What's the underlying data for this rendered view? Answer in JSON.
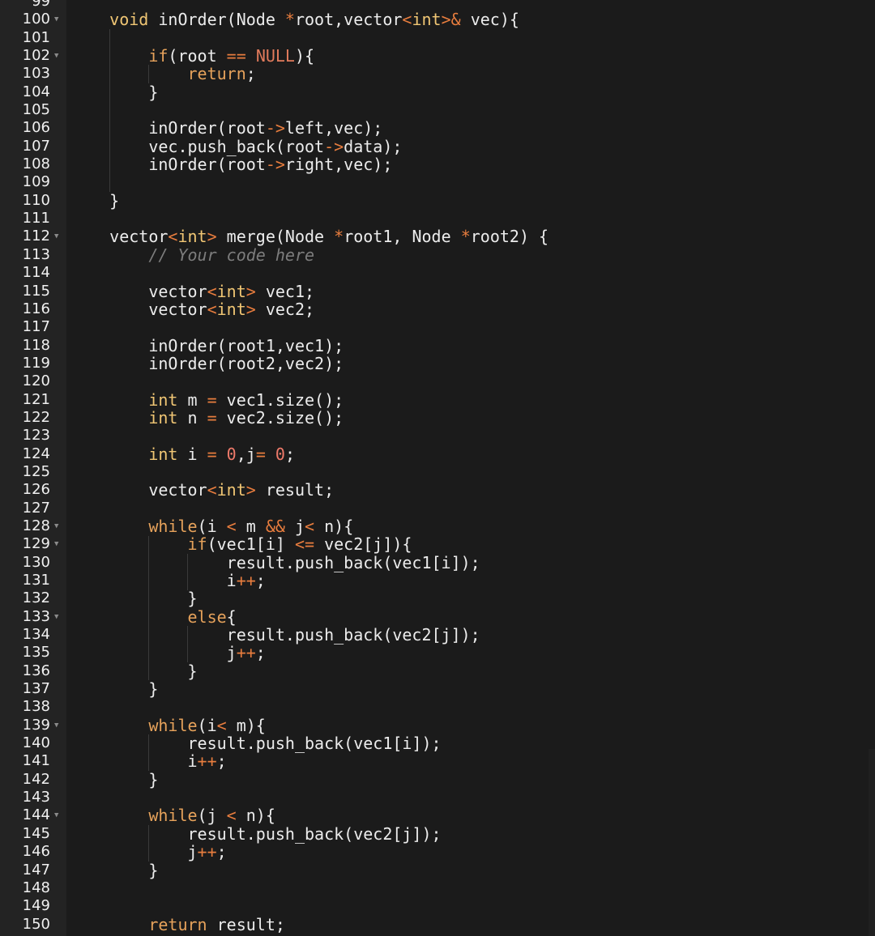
{
  "editor": {
    "first_line_number": 99,
    "folded_lines": [
      100,
      102,
      112,
      128,
      129,
      133,
      139,
      144
    ],
    "colors": {
      "background": "#1b1b1b",
      "gutter": "#232323",
      "text": "#ececec",
      "type_keyword": "#f0c674",
      "control_keyword": "#e6a25b",
      "operator": "#e87d3e",
      "number": "#ef7a6a",
      "comment": "#7d7d7d"
    },
    "lines": [
      [],
      [
        [
          "    ",
          "plain"
        ],
        [
          "void",
          "kw"
        ],
        [
          " inOrder(Node ",
          "plain"
        ],
        [
          "*",
          "op"
        ],
        [
          "root,vector",
          "plain"
        ],
        [
          "<",
          "op"
        ],
        [
          "int",
          "kw"
        ],
        [
          ">&",
          "op"
        ],
        [
          " vec){",
          "plain"
        ]
      ],
      [],
      [
        [
          "        ",
          "plain"
        ],
        [
          "if",
          "ctrl"
        ],
        [
          "(root ",
          "plain"
        ],
        [
          "==",
          "op"
        ],
        [
          " ",
          "plain"
        ],
        [
          "NULL",
          "const"
        ],
        [
          "){",
          "plain"
        ]
      ],
      [
        [
          "            ",
          "plain"
        ],
        [
          "return",
          "ctrl"
        ],
        [
          ";",
          "plain"
        ]
      ],
      [
        [
          "        }",
          "plain"
        ]
      ],
      [],
      [
        [
          "        inOrder(root",
          "plain"
        ],
        [
          "->",
          "op"
        ],
        [
          "left,vec);",
          "plain"
        ]
      ],
      [
        [
          "        vec.push_back(root",
          "plain"
        ],
        [
          "->",
          "op"
        ],
        [
          "data);",
          "plain"
        ]
      ],
      [
        [
          "        inOrder(root",
          "plain"
        ],
        [
          "->",
          "op"
        ],
        [
          "right,vec);",
          "plain"
        ]
      ],
      [],
      [
        [
          "    }",
          "plain"
        ]
      ],
      [],
      [
        [
          "    vector",
          "plain"
        ],
        [
          "<",
          "op"
        ],
        [
          "int",
          "kw"
        ],
        [
          ">",
          "op"
        ],
        [
          " merge(Node ",
          "plain"
        ],
        [
          "*",
          "op"
        ],
        [
          "root1, Node ",
          "plain"
        ],
        [
          "*",
          "op"
        ],
        [
          "root2) {",
          "plain"
        ]
      ],
      [
        [
          "        ",
          "plain"
        ],
        [
          "// Your code here",
          "comment"
        ]
      ],
      [],
      [
        [
          "        vector",
          "plain"
        ],
        [
          "<",
          "op"
        ],
        [
          "int",
          "kw"
        ],
        [
          ">",
          "op"
        ],
        [
          " vec1;",
          "plain"
        ]
      ],
      [
        [
          "        vector",
          "plain"
        ],
        [
          "<",
          "op"
        ],
        [
          "int",
          "kw"
        ],
        [
          ">",
          "op"
        ],
        [
          " vec2;",
          "plain"
        ]
      ],
      [],
      [
        [
          "        inOrder(root1,vec1);",
          "plain"
        ]
      ],
      [
        [
          "        inOrder(root2,vec2);",
          "plain"
        ]
      ],
      [],
      [
        [
          "        ",
          "plain"
        ],
        [
          "int",
          "kw"
        ],
        [
          " m ",
          "plain"
        ],
        [
          "=",
          "op"
        ],
        [
          " vec1.size();",
          "plain"
        ]
      ],
      [
        [
          "        ",
          "plain"
        ],
        [
          "int",
          "kw"
        ],
        [
          " n ",
          "plain"
        ],
        [
          "=",
          "op"
        ],
        [
          " vec2.size();",
          "plain"
        ]
      ],
      [],
      [
        [
          "        ",
          "plain"
        ],
        [
          "int",
          "kw"
        ],
        [
          " i ",
          "plain"
        ],
        [
          "=",
          "op"
        ],
        [
          " ",
          "plain"
        ],
        [
          "0",
          "num"
        ],
        [
          ",j",
          "plain"
        ],
        [
          "=",
          "op"
        ],
        [
          " ",
          "plain"
        ],
        [
          "0",
          "num"
        ],
        [
          ";",
          "plain"
        ]
      ],
      [],
      [
        [
          "        vector",
          "plain"
        ],
        [
          "<",
          "op"
        ],
        [
          "int",
          "kw"
        ],
        [
          ">",
          "op"
        ],
        [
          " result;",
          "plain"
        ]
      ],
      [],
      [
        [
          "        ",
          "plain"
        ],
        [
          "while",
          "ctrl"
        ],
        [
          "(i ",
          "plain"
        ],
        [
          "<",
          "op"
        ],
        [
          " m ",
          "plain"
        ],
        [
          "&&",
          "op"
        ],
        [
          " j",
          "plain"
        ],
        [
          "<",
          "op"
        ],
        [
          " n){",
          "plain"
        ]
      ],
      [
        [
          "            ",
          "plain"
        ],
        [
          "if",
          "ctrl"
        ],
        [
          "(vec1[i] ",
          "plain"
        ],
        [
          "<=",
          "op"
        ],
        [
          " vec2[j]){",
          "plain"
        ]
      ],
      [
        [
          "                result.push_back(vec1[i]);",
          "plain"
        ]
      ],
      [
        [
          "                i",
          "plain"
        ],
        [
          "++",
          "op"
        ],
        [
          ";",
          "plain"
        ]
      ],
      [
        [
          "            }",
          "plain"
        ]
      ],
      [
        [
          "            ",
          "plain"
        ],
        [
          "else",
          "ctrl"
        ],
        [
          "{",
          "plain"
        ]
      ],
      [
        [
          "                result.push_back(vec2[j]);",
          "plain"
        ]
      ],
      [
        [
          "                j",
          "plain"
        ],
        [
          "++",
          "op"
        ],
        [
          ";",
          "plain"
        ]
      ],
      [
        [
          "            }",
          "plain"
        ]
      ],
      [
        [
          "        }",
          "plain"
        ]
      ],
      [],
      [
        [
          "        ",
          "plain"
        ],
        [
          "while",
          "ctrl"
        ],
        [
          "(i",
          "plain"
        ],
        [
          "<",
          "op"
        ],
        [
          " m){",
          "plain"
        ]
      ],
      [
        [
          "            result.push_back(vec1[i]);",
          "plain"
        ]
      ],
      [
        [
          "            i",
          "plain"
        ],
        [
          "++",
          "op"
        ],
        [
          ";",
          "plain"
        ]
      ],
      [
        [
          "        }",
          "plain"
        ]
      ],
      [],
      [
        [
          "        ",
          "plain"
        ],
        [
          "while",
          "ctrl"
        ],
        [
          "(j ",
          "plain"
        ],
        [
          "<",
          "op"
        ],
        [
          " n){",
          "plain"
        ]
      ],
      [
        [
          "            result.push_back(vec2[j]);",
          "plain"
        ]
      ],
      [
        [
          "            j",
          "plain"
        ],
        [
          "++",
          "op"
        ],
        [
          ";",
          "plain"
        ]
      ],
      [
        [
          "        }",
          "plain"
        ]
      ],
      [],
      [],
      [
        [
          "        ",
          "plain"
        ],
        [
          "return",
          "ctrl"
        ],
        [
          " result;",
          "plain"
        ]
      ],
      []
    ]
  }
}
